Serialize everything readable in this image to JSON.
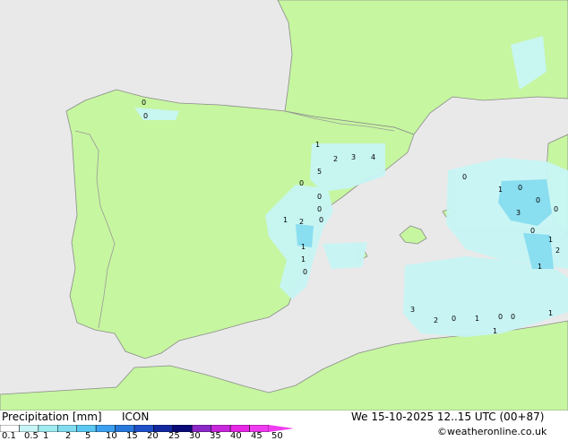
{
  "map": {
    "colors": {
      "sea": "#e9e9e9",
      "land": "#c6f6a0",
      "coast": "#8a8a8a",
      "border": "#9a9a9a",
      "label": "#000000"
    },
    "precip_labels": [
      "0",
      "0",
      "1",
      "2",
      "3",
      "4",
      "5",
      "0",
      "0",
      "0",
      "1",
      "2",
      "0",
      "1",
      "1",
      "0",
      "1",
      "3",
      "2",
      "0",
      "1",
      "0",
      "0",
      "1",
      "0",
      "1",
      "0",
      "0",
      "0",
      "0",
      "1",
      "2",
      "1",
      "3"
    ]
  },
  "footer": {
    "title": "Precipitation [mm]",
    "model": "ICON",
    "datetime": "We 15-10-2025 12..15 UTC (00+87)",
    "credit": "©weatheronline.co.uk",
    "scale_labels": [
      "0.1",
      "0.5",
      "1",
      "2",
      "5",
      "10",
      "15",
      "20",
      "25",
      "30",
      "35",
      "40",
      "45",
      "50"
    ],
    "scale_colors": [
      "#ffffff",
      "#c8f5f5",
      "#a0ebf0",
      "#82dcf0",
      "#5ac8f0",
      "#3ca0f0",
      "#2878dc",
      "#1e50c8",
      "#1428a0",
      "#0a0a78",
      "#8c28c8",
      "#c828dc",
      "#e628e6",
      "#f03cf0"
    ]
  }
}
